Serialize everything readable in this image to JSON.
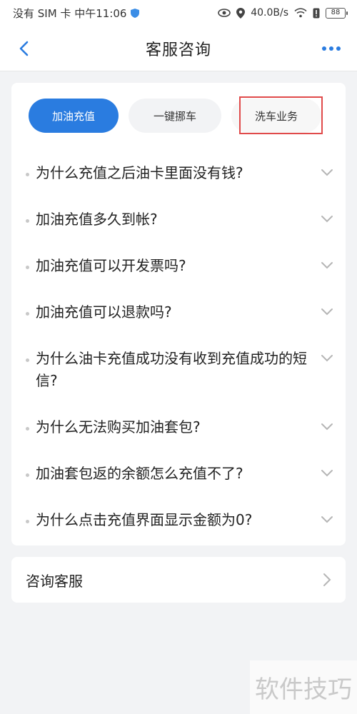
{
  "status_bar": {
    "carrier_time": "没有 SIM 卡 中午11:06",
    "net_speed": "40.0B/s",
    "battery": "88"
  },
  "nav": {
    "title": "客服咨询"
  },
  "tabs": [
    {
      "label": "加油充值",
      "active": true
    },
    {
      "label": "一键挪车",
      "active": false
    },
    {
      "label": "洗车业务",
      "active": false
    }
  ],
  "faq": [
    "为什么充值之后油卡里面没有钱?",
    "加油充值多久到帐?",
    "加油充值可以开发票吗?",
    "加油充值可以退款吗?",
    "为什么油卡充值成功没有收到充值成功的短信?",
    "为什么无法购买加油套包?",
    "加油套包返的余额怎么充值不了?",
    "为什么点击充值界面显示金额为0?"
  ],
  "consult": {
    "label": "咨询客服"
  },
  "watermark": "软件技巧",
  "colors": {
    "accent": "#2a7ce0",
    "highlight": "#e04a4a"
  }
}
